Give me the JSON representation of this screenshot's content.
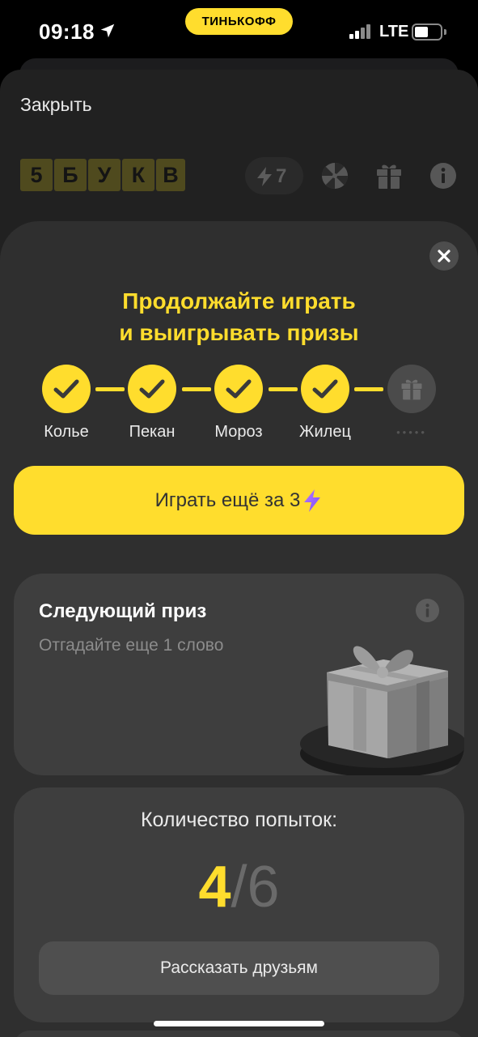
{
  "status_bar": {
    "time": "09:18",
    "brand": "ТИНЬКОФФ",
    "network": "LTE",
    "icons": [
      "location-arrow-icon",
      "signal-bars-icon",
      "battery-icon"
    ]
  },
  "header": {
    "close_label": "Закрыть",
    "logo_letters": [
      "5",
      "Б",
      "У",
      "К",
      "В"
    ],
    "energy_count": "7",
    "icons": [
      "lightning-icon",
      "wheel-icon",
      "gift-icon",
      "info-icon"
    ]
  },
  "modal": {
    "title_line1": "Продолжайте играть",
    "title_line2": "и выигрывать призы",
    "steps": [
      {
        "label": "Колье",
        "done": true
      },
      {
        "label": "Пекан",
        "done": true
      },
      {
        "label": "Мороз",
        "done": true
      },
      {
        "label": "Жилец",
        "done": true
      },
      {
        "label": "•••••",
        "done": false
      }
    ],
    "play_button": {
      "label": "Играть ещё за 3",
      "icon": "lightning-icon"
    }
  },
  "prize_card": {
    "title": "Следующий приз",
    "subtitle": "Отгадайте еще 1 слово",
    "icon": "info-icon"
  },
  "attempts_card": {
    "label": "Количество попыток:",
    "used": "4",
    "separator": "/",
    "total": "6",
    "share_button": "Рассказать друзьям"
  },
  "colors": {
    "accent": "#ffdd2d",
    "background": "#212121",
    "modal": "#2f2f2f",
    "card": "#3e3e3e"
  }
}
